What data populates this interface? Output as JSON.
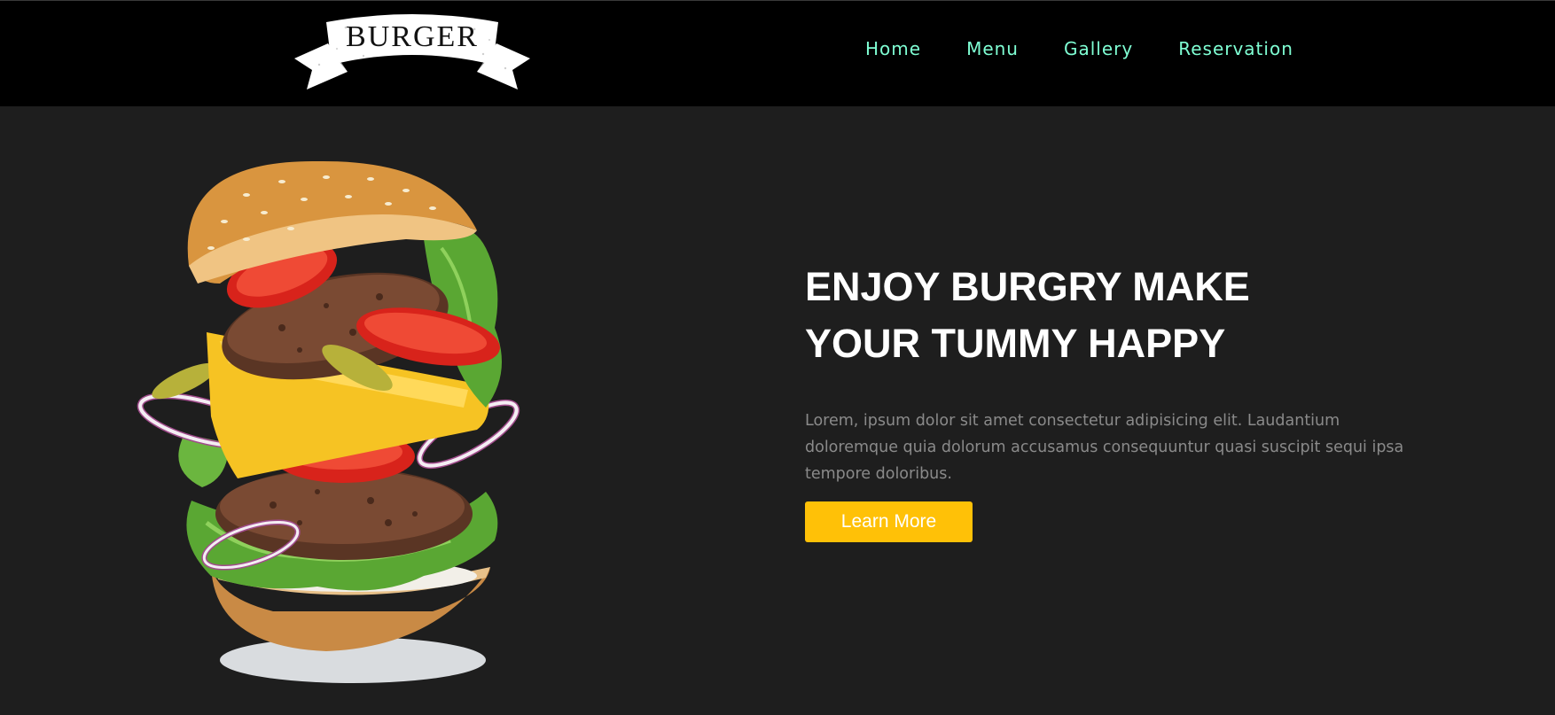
{
  "colors": {
    "header_bg": "#000000",
    "page_bg": "#1e1e1e",
    "nav_link": "#7fffd4",
    "accent": "#ffc107",
    "heading": "#ffffff",
    "body_text": "#8a8a8a"
  },
  "logo": {
    "text": "BURGER",
    "icon": "ribbon-banner-icon"
  },
  "nav": {
    "items": [
      {
        "label": "Home"
      },
      {
        "label": "Menu"
      },
      {
        "label": "Gallery"
      },
      {
        "label": "Reservation"
      }
    ]
  },
  "hero": {
    "headline_line1": "ENJOY BURGRY MAKE",
    "headline_line2": "YOUR TUMMY HAPPY",
    "description": "Lorem, ipsum dolor sit amet consectetur adipisicing elit. Laudantium doloremque quia dolorum accusamus consequuntur quasi suscipit sequi ipsa tempore doloribus.",
    "cta_label": "Learn More",
    "image": "floating-burger-illustration"
  }
}
